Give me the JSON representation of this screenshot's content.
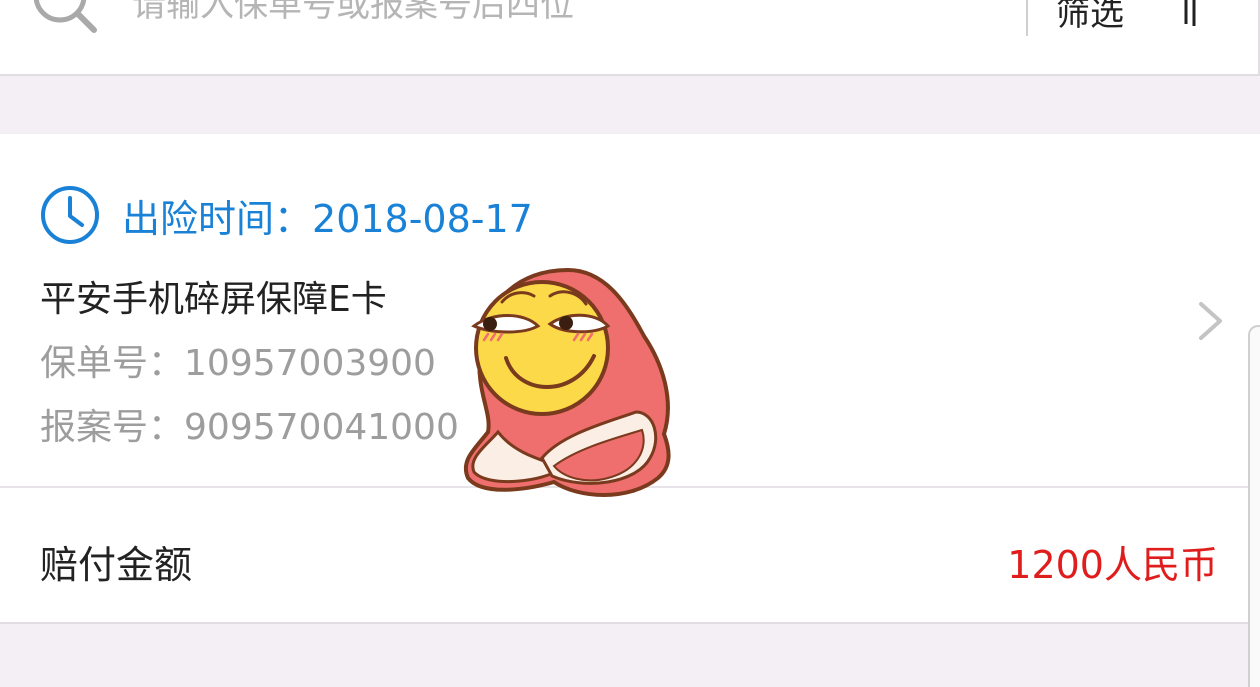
{
  "search": {
    "placeholder": "请输入保单号或报案号后四位",
    "filter_label": "筛选"
  },
  "claim": {
    "time_label": "出险时间：",
    "time_value": "2018-08-17",
    "product_name": "平安手机碎屏保障E卡",
    "policy_label": "保单号：",
    "policy_number": "10957003900",
    "report_label": "报案号：",
    "report_number": "909570041000",
    "payout_label": "赔付金额",
    "payout_value": "1200人民币"
  },
  "icons": {
    "search": "search-icon",
    "filter": "filter-icon",
    "clock": "clock-icon",
    "chevron": "chevron-right-icon",
    "sticker": "emoji-sticker"
  },
  "colors": {
    "accent_blue": "#1a82d6",
    "payout_red": "#e01d1d",
    "page_background": "#f4eef5"
  }
}
